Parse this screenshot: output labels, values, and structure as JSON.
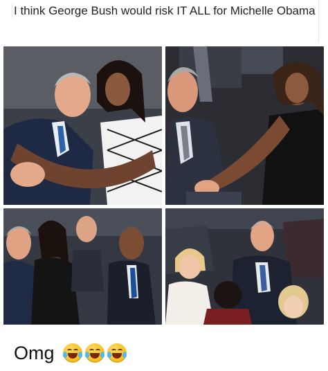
{
  "post": {
    "caption": "I think George Bush would risk IT ALL for Michelle Obama",
    "footer_text": "Omg",
    "emojis": [
      "face-with-tears-of-joy",
      "face-with-tears-of-joy",
      "face-with-tears-of-joy"
    ]
  },
  "colors": {
    "background": "#ffffff",
    "text": "#222222",
    "emoji_yellow": "#f4b400",
    "tear_blue": "#52b8f2"
  },
  "panels": [
    {
      "name": "hug-photo"
    },
    {
      "name": "hand-on-knee-photo"
    },
    {
      "name": "cheek-kiss-photo"
    },
    {
      "name": "crowd-photo"
    }
  ]
}
